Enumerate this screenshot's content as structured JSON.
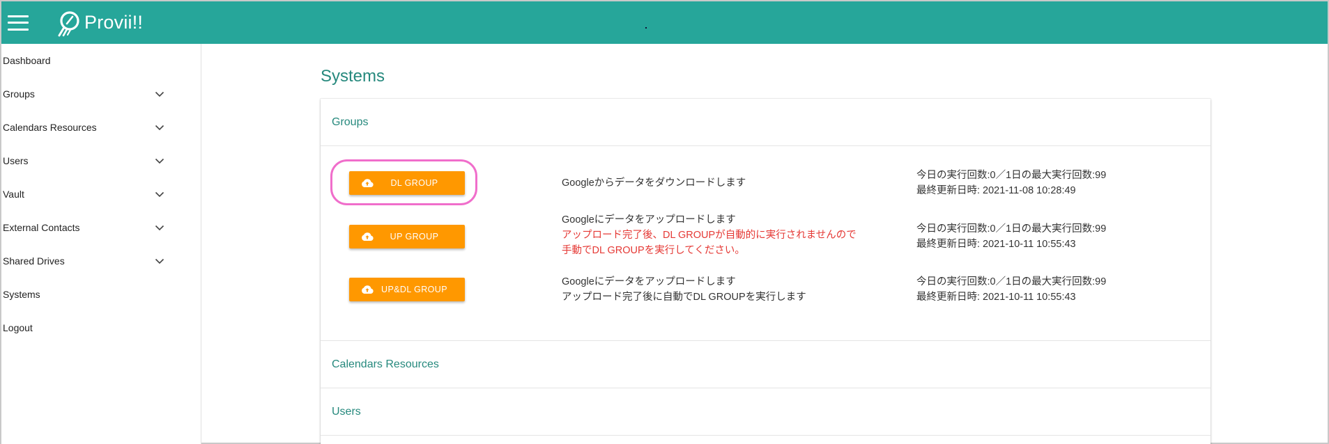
{
  "header": {
    "brand": "Provii!!"
  },
  "sidebar": {
    "items": [
      {
        "label": "Dashboard",
        "expandable": false
      },
      {
        "label": "Groups",
        "expandable": true
      },
      {
        "label": "Calendars Resources",
        "expandable": true
      },
      {
        "label": "Users",
        "expandable": true
      },
      {
        "label": "Vault",
        "expandable": true
      },
      {
        "label": "External Contacts",
        "expandable": true
      },
      {
        "label": "Shared Drives",
        "expandable": true
      },
      {
        "label": "Systems",
        "expandable": false
      },
      {
        "label": "Logout",
        "expandable": false
      }
    ]
  },
  "main": {
    "title": "Systems",
    "sections": [
      {
        "title": "Groups"
      },
      {
        "title": "Calendars Resources"
      },
      {
        "title": "Users"
      }
    ],
    "groups_actions": [
      {
        "button_label": "DL GROUP",
        "description": [
          "Googleからデータをダウンロードします"
        ],
        "warning": [],
        "stats_line1": "今日の実行回数:0／1日の最大実行回数:99",
        "stats_line2": "最終更新日時: 2021-11-08 10:28:49"
      },
      {
        "button_label": "UP GROUP",
        "description": [
          "Googleにデータをアップロードします"
        ],
        "warning": [
          "アップロード完了後、DL GROUPが自動的に実行されませんので",
          "手動でDL GROUPを実行してください。"
        ],
        "stats_line1": "今日の実行回数:0／1日の最大実行回数:99",
        "stats_line2": "最終更新日時: 2021-10-11 10:55:43"
      },
      {
        "button_label": "UP&DL GROUP",
        "description": [
          "Googleにデータをアップロードします",
          "アップロード完了後に自動でDL GROUPを実行します"
        ],
        "warning": [],
        "stats_line1": "今日の実行回数:0／1日の最大実行回数:99",
        "stats_line2": "最終更新日時: 2021-10-11 10:55:43"
      }
    ]
  },
  "colors": {
    "topbar": "#26a69a",
    "accent_text": "#26897d",
    "button": "#ff9800",
    "warning": "#e53935",
    "highlight": "#f06ecb"
  },
  "icons": {
    "menu": "hamburger-icon",
    "logo": "provii-logo-icon",
    "expand": "chevron-down-icon",
    "button": "cloud-upload-icon"
  }
}
